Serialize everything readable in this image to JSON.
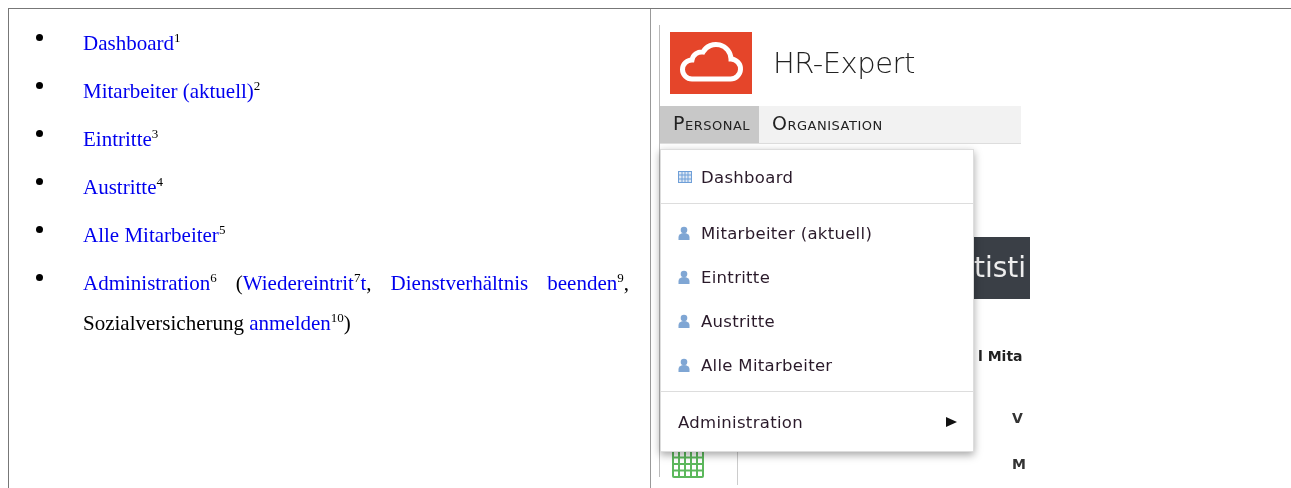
{
  "bullet_list": [
    {
      "segments": [
        {
          "kind": "link",
          "text": "Dashboard$^{1}$"
        }
      ]
    },
    {
      "segments": [
        {
          "kind": "link",
          "text": "Mitarbeiter (aktuell)$^{2}$"
        }
      ]
    },
    {
      "segments": [
        {
          "kind": "link",
          "text": "Eintritte$^{3}$"
        }
      ]
    },
    {
      "segments": [
        {
          "kind": "link",
          "text": "Austritte$^{4}$"
        }
      ]
    },
    {
      "segments": [
        {
          "kind": "link",
          "text": "Alle Mitarbeiter$^{5}$"
        }
      ]
    },
    {
      "segments": [
        {
          "kind": "link",
          "text": "Administration$^{6}$"
        },
        {
          "kind": "plain",
          "text": " ("
        },
        {
          "kind": "link",
          "text": "Wiedereintrit$^{7}$t"
        },
        {
          "kind": "plain",
          "text": ", "
        },
        {
          "kind": "link",
          "text": "Dienstverhältnis beenden$^{9}$"
        },
        {
          "kind": "plain",
          "text": ", Sozialversicherung "
        },
        {
          "kind": "link",
          "text": "anmelden$^{10}$"
        },
        {
          "kind": "plain",
          "text": ")"
        }
      ]
    }
  ],
  "app": {
    "title": "HR-Expert",
    "menu": [
      {
        "label": "Personal",
        "selected": true
      },
      {
        "label": "Organisation",
        "selected": false
      }
    ],
    "dropdown": [
      {
        "kind": "dashboard",
        "label": "Dashboard"
      },
      {
        "kind": "separator"
      },
      {
        "kind": "person",
        "label": "Mitarbeiter (aktuell)"
      },
      {
        "kind": "person",
        "label": "Eintritte"
      },
      {
        "kind": "person",
        "label": "Austritte"
      },
      {
        "kind": "person",
        "label": "Alle Mitarbeiter"
      },
      {
        "kind": "separator"
      },
      {
        "kind": "submenu",
        "label": "Administration"
      }
    ],
    "background": {
      "banner": "tisti",
      "heading": "l Mita",
      "row_labels": [
        "V",
        "M"
      ]
    }
  }
}
